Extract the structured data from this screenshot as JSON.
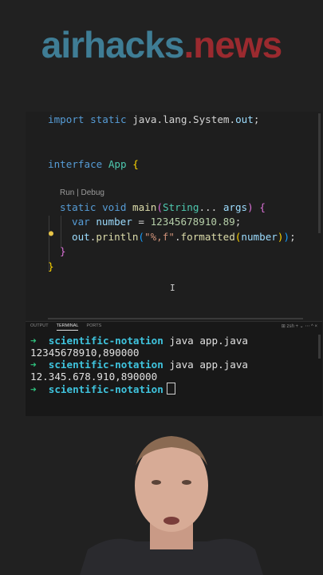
{
  "brand": {
    "part1": "airhacks",
    "dot": ".",
    "part2": "news"
  },
  "editor": {
    "line1": {
      "import": "import",
      "static": "static",
      "path": "java.lang.System.",
      "out": "out",
      "semi": ";"
    },
    "line2": {
      "interface": "interface",
      "name": "App",
      "brace": "{"
    },
    "codelens": "Run | Debug",
    "line3": {
      "static": "static",
      "void": "void",
      "main": "main",
      "open": "(",
      "type": "String",
      "rest": "... ",
      "args": "args",
      "close": ")",
      "brace": "{"
    },
    "line4": {
      "var": "var",
      "number": "number",
      "eq": " = ",
      "value": "12345678910.89",
      "semi": ";"
    },
    "line5": {
      "out": "out",
      "dot1": ".",
      "println": "println",
      "open": "(",
      "str": "\"%,f\"",
      "dot2": ".",
      "formatted": "formatted",
      "open2": "(",
      "number": "number",
      "close2": ")",
      "close": ")",
      "semi": ";"
    },
    "line6": {
      "brace": "}"
    },
    "line7": {
      "brace": "}"
    }
  },
  "panel": {
    "tabs": [
      "OUTPUT",
      "TERMINAL",
      "PORTS"
    ],
    "tools": "⊞ zsh  +  ⌄  ⋯  ^  ×",
    "terminal": [
      {
        "type": "prompt",
        "arrow": "➜",
        "dir": "scientific-notation",
        "cmd": "java app.java"
      },
      {
        "type": "output",
        "text": "12345678910,890000"
      },
      {
        "type": "prompt",
        "arrow": "➜",
        "dir": "scientific-notation",
        "cmd": "java app.java"
      },
      {
        "type": "output",
        "text": "12.345.678.910,890000"
      },
      {
        "type": "prompt",
        "arrow": "➜",
        "dir": "scientific-notation",
        "cmd": ""
      }
    ]
  }
}
